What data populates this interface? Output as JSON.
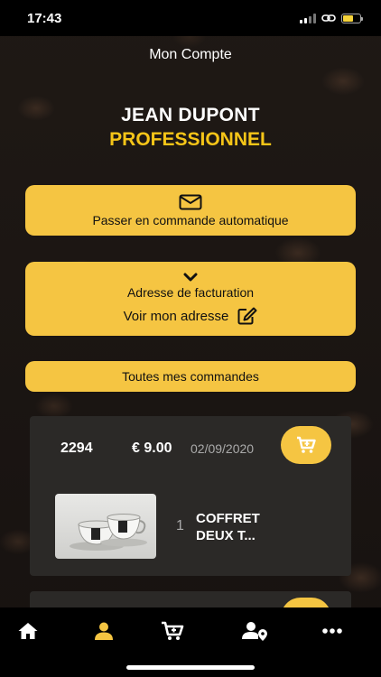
{
  "status_bar": {
    "time": "17:43"
  },
  "header": {
    "title": "Mon Compte"
  },
  "user": {
    "name": "JEAN DUPONT",
    "type": "PROFESSIONNEL"
  },
  "actions": {
    "auto_order_label": "Passer en commande automatique",
    "billing_label": "Adresse de facturation",
    "view_address_label": "Voir mon adresse",
    "all_orders_label": "Toutes mes commandes"
  },
  "orders": [
    {
      "id": "2294",
      "price": "€ 9.00",
      "date": "02/09/2020",
      "item": {
        "quantity": "1",
        "name": "COFFRET DEUX T..."
      }
    }
  ],
  "tabs": [
    {
      "icon": "home-icon",
      "active": false
    },
    {
      "icon": "account-icon",
      "active": true
    },
    {
      "icon": "cart-icon",
      "active": false
    },
    {
      "icon": "user-location-icon",
      "active": false
    },
    {
      "icon": "more-icon",
      "active": false
    }
  ],
  "colors": {
    "accent": "#f5c542",
    "background": "#1a1512",
    "card": "#2b2927",
    "user_type": "#f5c518"
  }
}
